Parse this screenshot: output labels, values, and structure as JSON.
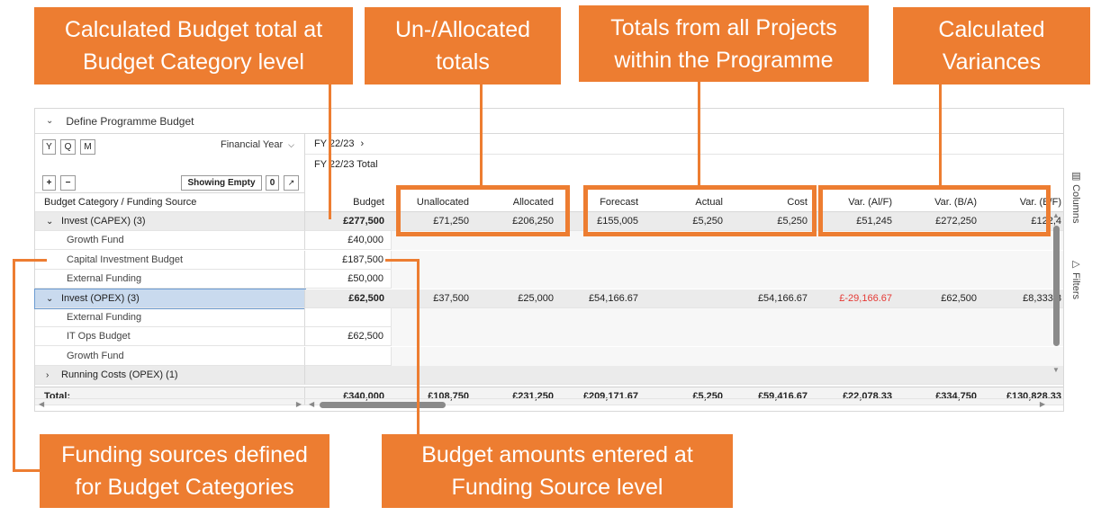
{
  "callouts": {
    "budget_total": "Calculated Budget total at\nBudget Category level",
    "allocated": "Un-/Allocated\ntotals",
    "projects": "Totals from all Projects\nwithin the Programme",
    "variances": "Calculated\nVariances",
    "funding_sources": "Funding sources defined\nfor Budget Categories",
    "budget_entered": "Budget amounts entered at\nFunding Source level"
  },
  "panel": {
    "title": "Define Programme Budget",
    "period_buttons": [
      "Y",
      "Q",
      "M"
    ],
    "period_select": "Financial Year",
    "expand_label": "+",
    "collapse_label": "−",
    "showing_empty_label": "Showing Empty",
    "empty_count": "0",
    "period_header": "FY 22/23",
    "period_total_header": "FY 22/23 Total",
    "row_header": "Budget Category / Funding Source",
    "columns_label": "Columns",
    "filters_label": "Filters"
  },
  "columns": [
    "Budget",
    "Unallocated",
    "Allocated",
    "Forecast",
    "Actual",
    "Cost",
    "Var. (Al/F)",
    "Var. (B/A)",
    "Var. (B/F)"
  ],
  "rows": [
    {
      "label": "Invest (CAPEX) (3)",
      "type": "group",
      "expanded": true,
      "values": [
        "£277,500",
        "£71,250",
        "£206,250",
        "£155,005",
        "£5,250",
        "£5,250",
        "£51,245",
        "£272,250",
        "£122,4"
      ]
    },
    {
      "label": "Growth Fund",
      "type": "child",
      "values": [
        "£40,000",
        "",
        "",
        "",
        "",
        "",
        "",
        "",
        ""
      ]
    },
    {
      "label": "Capital Investment Budget",
      "type": "child",
      "values": [
        "£187,500",
        "",
        "",
        "",
        "",
        "",
        "",
        "",
        ""
      ]
    },
    {
      "label": "External Funding",
      "type": "child",
      "values": [
        "£50,000",
        "",
        "",
        "",
        "",
        "",
        "",
        "",
        ""
      ]
    },
    {
      "label": "Invest (OPEX) (3)",
      "type": "group",
      "expanded": true,
      "selected": true,
      "values": [
        "£62,500",
        "£37,500",
        "£25,000",
        "£54,166.67",
        "",
        "£54,166.67",
        "£-29,166.67",
        "£62,500",
        "£8,333.3"
      ]
    },
    {
      "label": "External Funding",
      "type": "child",
      "values": [
        "",
        "",
        "",
        "",
        "",
        "",
        "",
        "",
        ""
      ]
    },
    {
      "label": "IT Ops Budget",
      "type": "child",
      "values": [
        "£62,500",
        "",
        "",
        "",
        "",
        "",
        "",
        "",
        ""
      ]
    },
    {
      "label": "Growth Fund",
      "type": "child",
      "values": [
        "",
        "",
        "",
        "",
        "",
        "",
        "",
        "",
        ""
      ]
    },
    {
      "label": "Running Costs (OPEX) (1)",
      "type": "group",
      "expanded": false,
      "values": [
        "",
        "",
        "",
        "",
        "",
        "",
        "",
        "",
        ""
      ]
    }
  ],
  "totals": {
    "label": "Total:",
    "values": [
      "£340,000",
      "£108,750",
      "£231,250",
      "£209,171.67",
      "£5,250",
      "£59,416.67",
      "£22,078.33",
      "£334,750",
      "£130,828.33"
    ]
  },
  "colors": {
    "accent": "#ED7D31",
    "negative": "#E53935",
    "selected": "#C9DAEE"
  }
}
